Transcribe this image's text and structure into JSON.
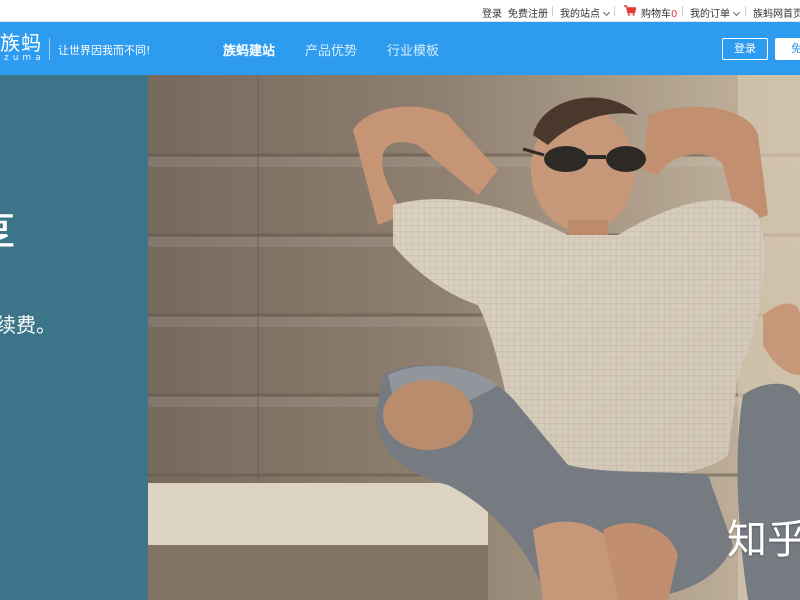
{
  "topbar": {
    "login": "登录",
    "register": "免费注册",
    "my_site": "我的站点",
    "cart_label": "购物车",
    "cart_count": "0",
    "my_orders": "我的订单",
    "home": "族蚂网首页"
  },
  "navbar": {
    "logo_cn": "族蚂",
    "logo_en": "zuma",
    "slogan": "让世界因我而不同!",
    "links": [
      "族蚂建站",
      "产品优势",
      "行业模板"
    ],
    "login_button": "登录",
    "register_button": "免费"
  },
  "hero": {
    "headline_fragment": "享",
    "sub_fragment": "手续费。",
    "photo_caption": "知乎",
    "colors": {
      "nav_blue": "#2d9bf0",
      "left_panel": "#3c7489"
    }
  }
}
